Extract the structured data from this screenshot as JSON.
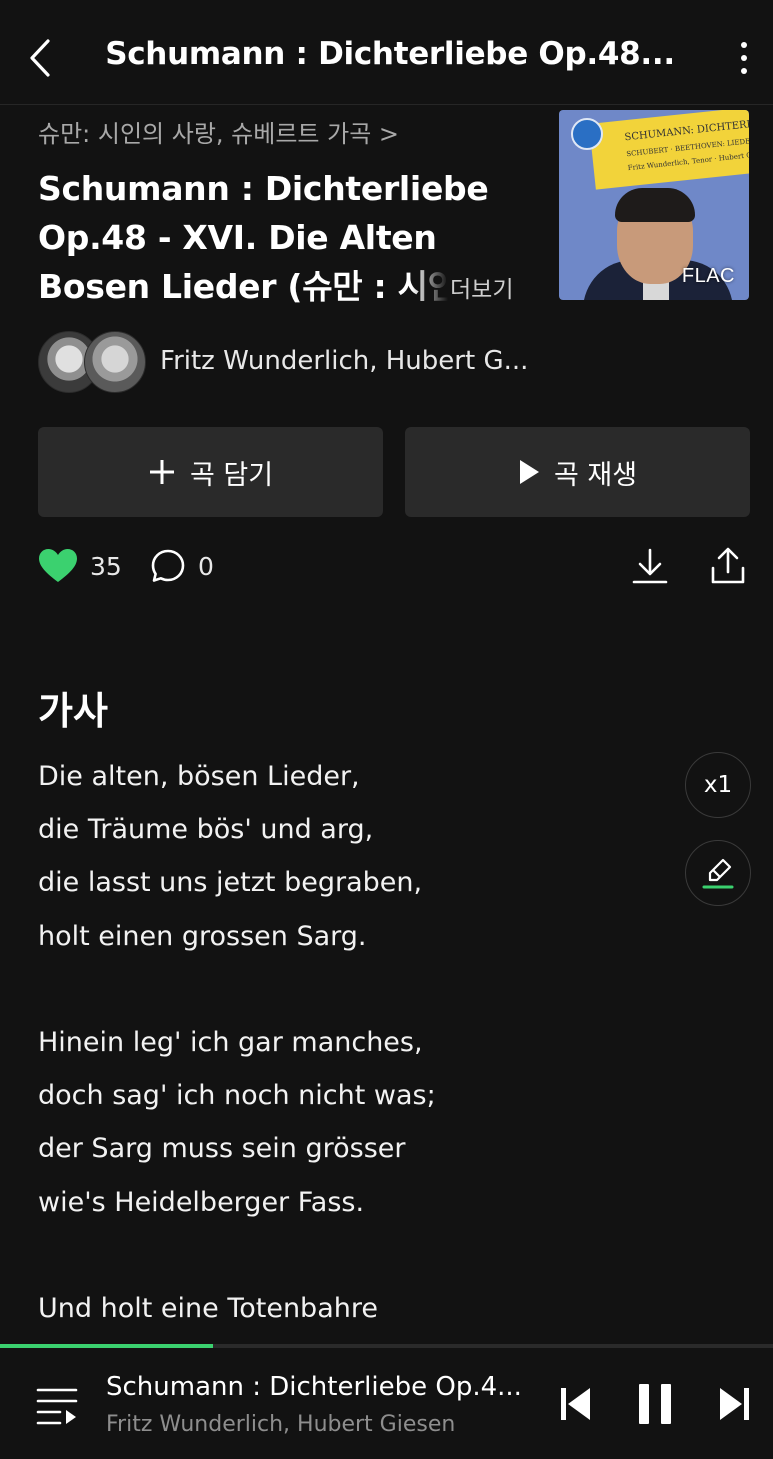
{
  "header": {
    "title": "Schumann : Dichterliebe Op.48...",
    "back_icon": "chevron-left-icon",
    "more_icon": "more-vertical-icon"
  },
  "song": {
    "album_link": "슈만: 시인의 사랑, 슈베르트 가곡 >",
    "title_lines": [
      "Schumann : Dichterliebe",
      "Op.48 - XVI. Die Alten",
      "Bosen Lieder (슈만 : 시인"
    ],
    "more_label": "더보기",
    "format_badge": "FLAC",
    "cover_texts": [
      "SCHUMANN: DICHTERLIEBE",
      "SCHUBERT · BEETHOVEN: LIEDER",
      "Fritz Wunderlich, Tenor · Hubert Giesen, Piano"
    ],
    "artists": "Fritz Wunderlich, Hubert G..."
  },
  "buttons": {
    "add_label": "곡 담기",
    "play_label": "곡 재생"
  },
  "actions": {
    "like_count": "35",
    "comment_count": "0",
    "liked": true
  },
  "lyrics": {
    "heading": "가사",
    "stanzas": [
      [
        "Die alten, bösen Lieder,",
        "die Träume bös' und arg,",
        "die lasst uns jetzt begraben,",
        "holt einen grossen Sarg."
      ],
      [
        "Hinein leg' ich gar manches,",
        "doch sag' ich noch nicht was;",
        "der Sarg muss sein grösser",
        "wie's Heidelberger Fass."
      ],
      [
        "Und holt eine Totenbahre"
      ]
    ],
    "speed_label": "x1"
  },
  "player": {
    "title": "Schumann : Dichterliebe Op.4...",
    "artist": "Fritz Wunderlich, Hubert Giesen",
    "progress": 0.275,
    "state": "playing"
  },
  "colors": {
    "background": "#121212",
    "accent": "#3bd16f",
    "button_bg": "#2a2a2a",
    "muted_text": "#a8a8a8"
  }
}
